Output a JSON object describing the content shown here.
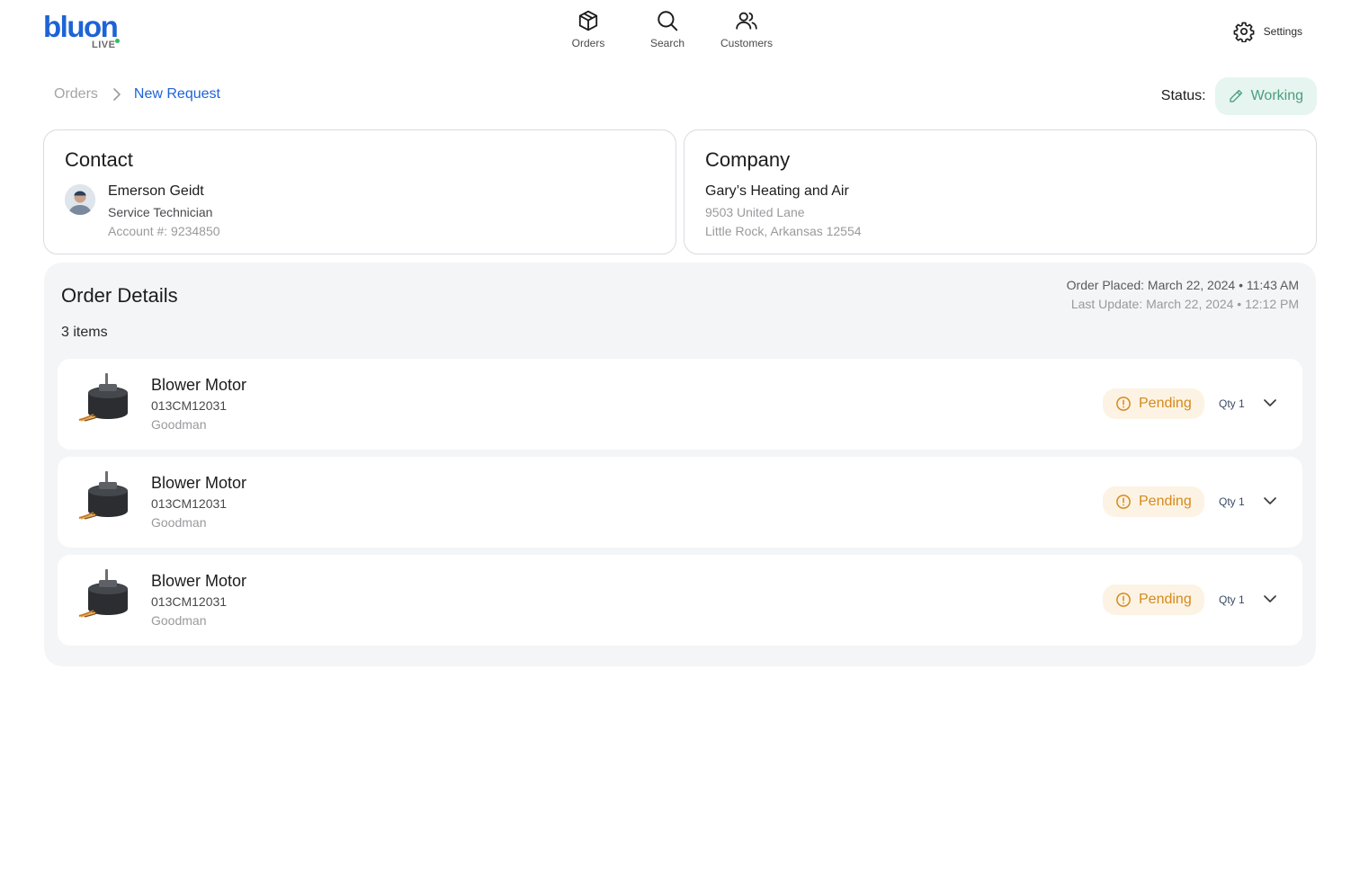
{
  "brand": {
    "name": "bluon",
    "sub": "LIVE",
    "color": "#1e63d6",
    "dot_color": "#2fbf5b"
  },
  "nav": [
    {
      "label": "Orders",
      "icon": "package-icon"
    },
    {
      "label": "Search",
      "icon": "search-icon"
    },
    {
      "label": "Customers",
      "icon": "users-icon"
    }
  ],
  "settings": {
    "label": "Settings",
    "icon": "gear-icon"
  },
  "breadcrumb": {
    "root": "Orders",
    "current": "New Request"
  },
  "status": {
    "label": "Status:",
    "value": "Working",
    "icon": "pencil-icon",
    "color": "#4a9e7e"
  },
  "contact": {
    "title": "Contact",
    "name": "Emerson Geidt",
    "role": "Service Technician",
    "account": "Account #: 9234850"
  },
  "company": {
    "title": "Company",
    "name": "Gary’s Heating and Air",
    "address_line1": "9503 United Lane",
    "address_line2": "Little Rock, Arkansas 12554"
  },
  "order": {
    "title": "Order Details",
    "count": "3 items",
    "placed": "Order Placed: March 22, 2024 • 11:43 AM",
    "updated": "Last Update: March 22, 2024 • 12:12 PM",
    "items": [
      {
        "name": "Blower Motor",
        "sku": "013CM12031",
        "brand": "Goodman",
        "status": "Pending",
        "qty": "Qty 1"
      },
      {
        "name": "Blower Motor",
        "sku": "013CM12031",
        "brand": "Goodman",
        "status": "Pending",
        "qty": "Qty 1"
      },
      {
        "name": "Blower Motor",
        "sku": "013CM12031",
        "brand": "Goodman",
        "status": "Pending",
        "qty": "Qty 1"
      }
    ]
  }
}
